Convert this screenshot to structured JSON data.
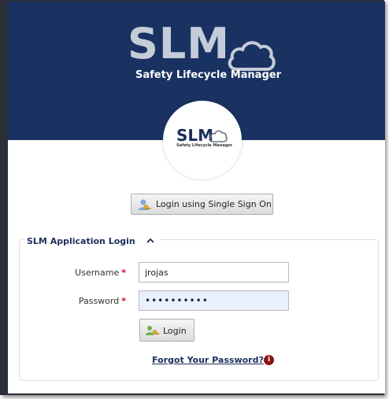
{
  "brand": {
    "logo_text": "SLM",
    "logo_subtitle": "Safety Lifecycle Manager",
    "banner_color": "#193262",
    "accent_color": "#8e1512"
  },
  "sso": {
    "label": "Login using Single Sign On",
    "icon": "key-user-icon"
  },
  "login_form": {
    "title": "SLM Application Login",
    "collapse_icon": "chevron-up-icon",
    "username_label": "Username",
    "username_value": "jrojas",
    "password_label": "Password",
    "password_value": "••••••••••",
    "required_marker": "*",
    "login_label": "Login",
    "login_icon": "users-key-icon",
    "forgot_label": "Forgot Your Password?",
    "info_badge": "i"
  }
}
